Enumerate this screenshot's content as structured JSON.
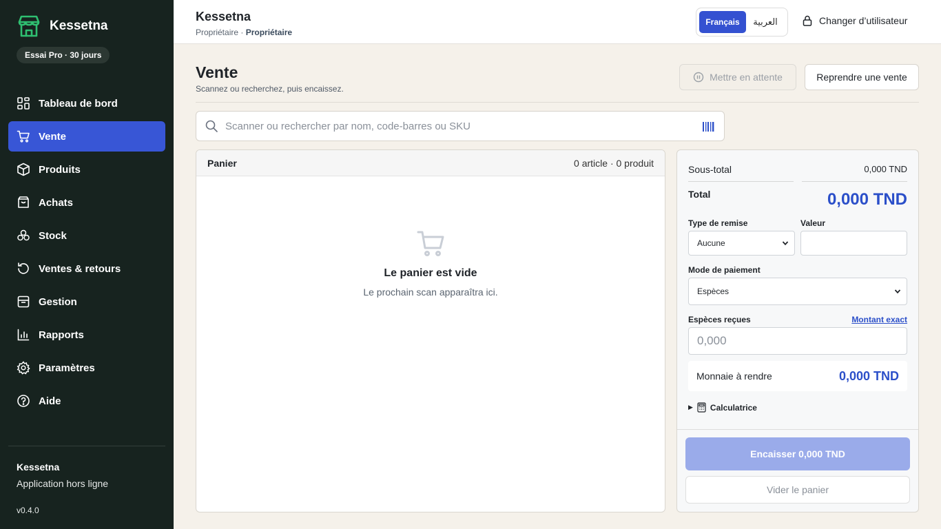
{
  "app": {
    "name": "Kessetna",
    "trial_badge": "Essai Pro · 30 jours",
    "accent": "#3856d6",
    "sidebar_bg": "#17231f"
  },
  "sidebar": {
    "items": [
      {
        "label": "Tableau de bord",
        "icon": "dashboard-icon"
      },
      {
        "label": "Vente",
        "icon": "cart-icon",
        "active": true
      },
      {
        "label": "Produits",
        "icon": "box-icon"
      },
      {
        "label": "Achats",
        "icon": "shopping-bag-icon"
      },
      {
        "label": "Stock",
        "icon": "boxes-icon"
      },
      {
        "label": "Ventes & retours",
        "icon": "history-icon"
      },
      {
        "label": "Gestion",
        "icon": "archive-icon"
      },
      {
        "label": "Rapports",
        "icon": "chart-icon"
      },
      {
        "label": "Paramètres",
        "icon": "gear-icon"
      },
      {
        "label": "Aide",
        "icon": "help-icon"
      }
    ],
    "footer": {
      "name": "Kessetna",
      "subtitle": "Application hors ligne",
      "version": "v0.4.0"
    }
  },
  "header": {
    "title": "Kessetna",
    "role_prefix": "Propriétaire · ",
    "role": "Propriétaire",
    "lang_fr": "Français",
    "lang_ar": "العربية",
    "switch_user": "Changer d’utilisateur"
  },
  "page": {
    "title": "Vente",
    "subtitle": "Scannez ou recherchez, puis encaissez.",
    "hold_button": "Mettre en attente",
    "resume_button": "Reprendre une vente"
  },
  "search": {
    "placeholder": "Scanner ou rechercher par nom, code-barres ou SKU"
  },
  "cart": {
    "title": "Panier",
    "count": "0 article · 0 produit",
    "empty_title": "Le panier est vide",
    "empty_sub": "Le prochain scan apparaîtra ici."
  },
  "summary": {
    "subtotal_label": "Sous-total",
    "subtotal_value": "0,000 TND",
    "total_label": "Total",
    "total_value": "0,000 TND",
    "discount_type_label": "Type de remise",
    "discount_type_value": "Aucune",
    "value_label": "Valeur",
    "payment_label": "Mode de paiement",
    "payment_value": "Espèces",
    "cash_label": "Espèces reçues",
    "exact_amount": "Montant exact",
    "cash_placeholder": "0,000",
    "change_label": "Monnaie à rendre",
    "change_value": "0,000 TND",
    "calculator": "Calculatrice",
    "pay_button": "Encaisser 0,000 TND",
    "clear_button": "Vider le panier"
  }
}
